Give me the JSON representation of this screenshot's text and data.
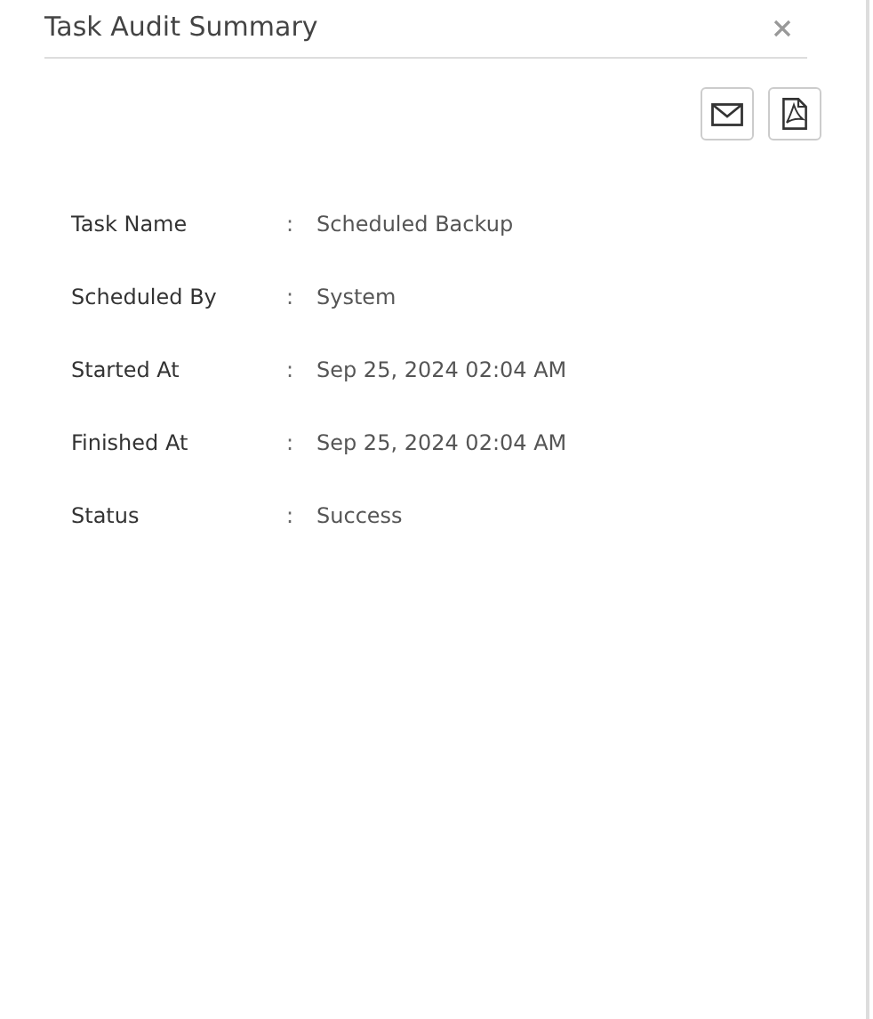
{
  "window": {
    "title": "Task Audit Summary"
  },
  "details": [
    {
      "label": "Task Name",
      "separator": ":",
      "value": "Scheduled Backup"
    },
    {
      "label": "Scheduled By",
      "separator": ":",
      "value": "System"
    },
    {
      "label": "Started At",
      "separator": ":",
      "value": "Sep 25, 2024 02:04 AM"
    },
    {
      "label": "Finished At",
      "separator": ":",
      "value": "Sep 25, 2024 02:04 AM"
    },
    {
      "label": "Status",
      "separator": ":",
      "value": "Success"
    }
  ]
}
